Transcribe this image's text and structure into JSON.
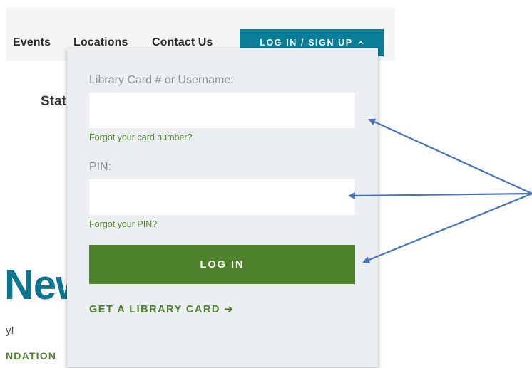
{
  "nav": {
    "events": "Events",
    "locations": "Locations",
    "contact": "Contact Us",
    "login_button": "LOG IN / SIGN UP"
  },
  "background": {
    "stat_text": "Stat",
    "new_text": "New",
    "y_text": "y!",
    "ndation_text": "NDATION"
  },
  "login_form": {
    "username_label": "Library Card # or Username:",
    "username_value": "",
    "forgot_card": "Forgot your card number?",
    "pin_label": "PIN:",
    "pin_value": "",
    "forgot_pin": "Forgot your PIN?",
    "submit_label": "LOG IN",
    "get_card": "GET A LIBRARY CARD ➔"
  },
  "colors": {
    "teal": "#0a7e97",
    "green": "#4f822d",
    "annotation_blue": "#4472c4"
  }
}
